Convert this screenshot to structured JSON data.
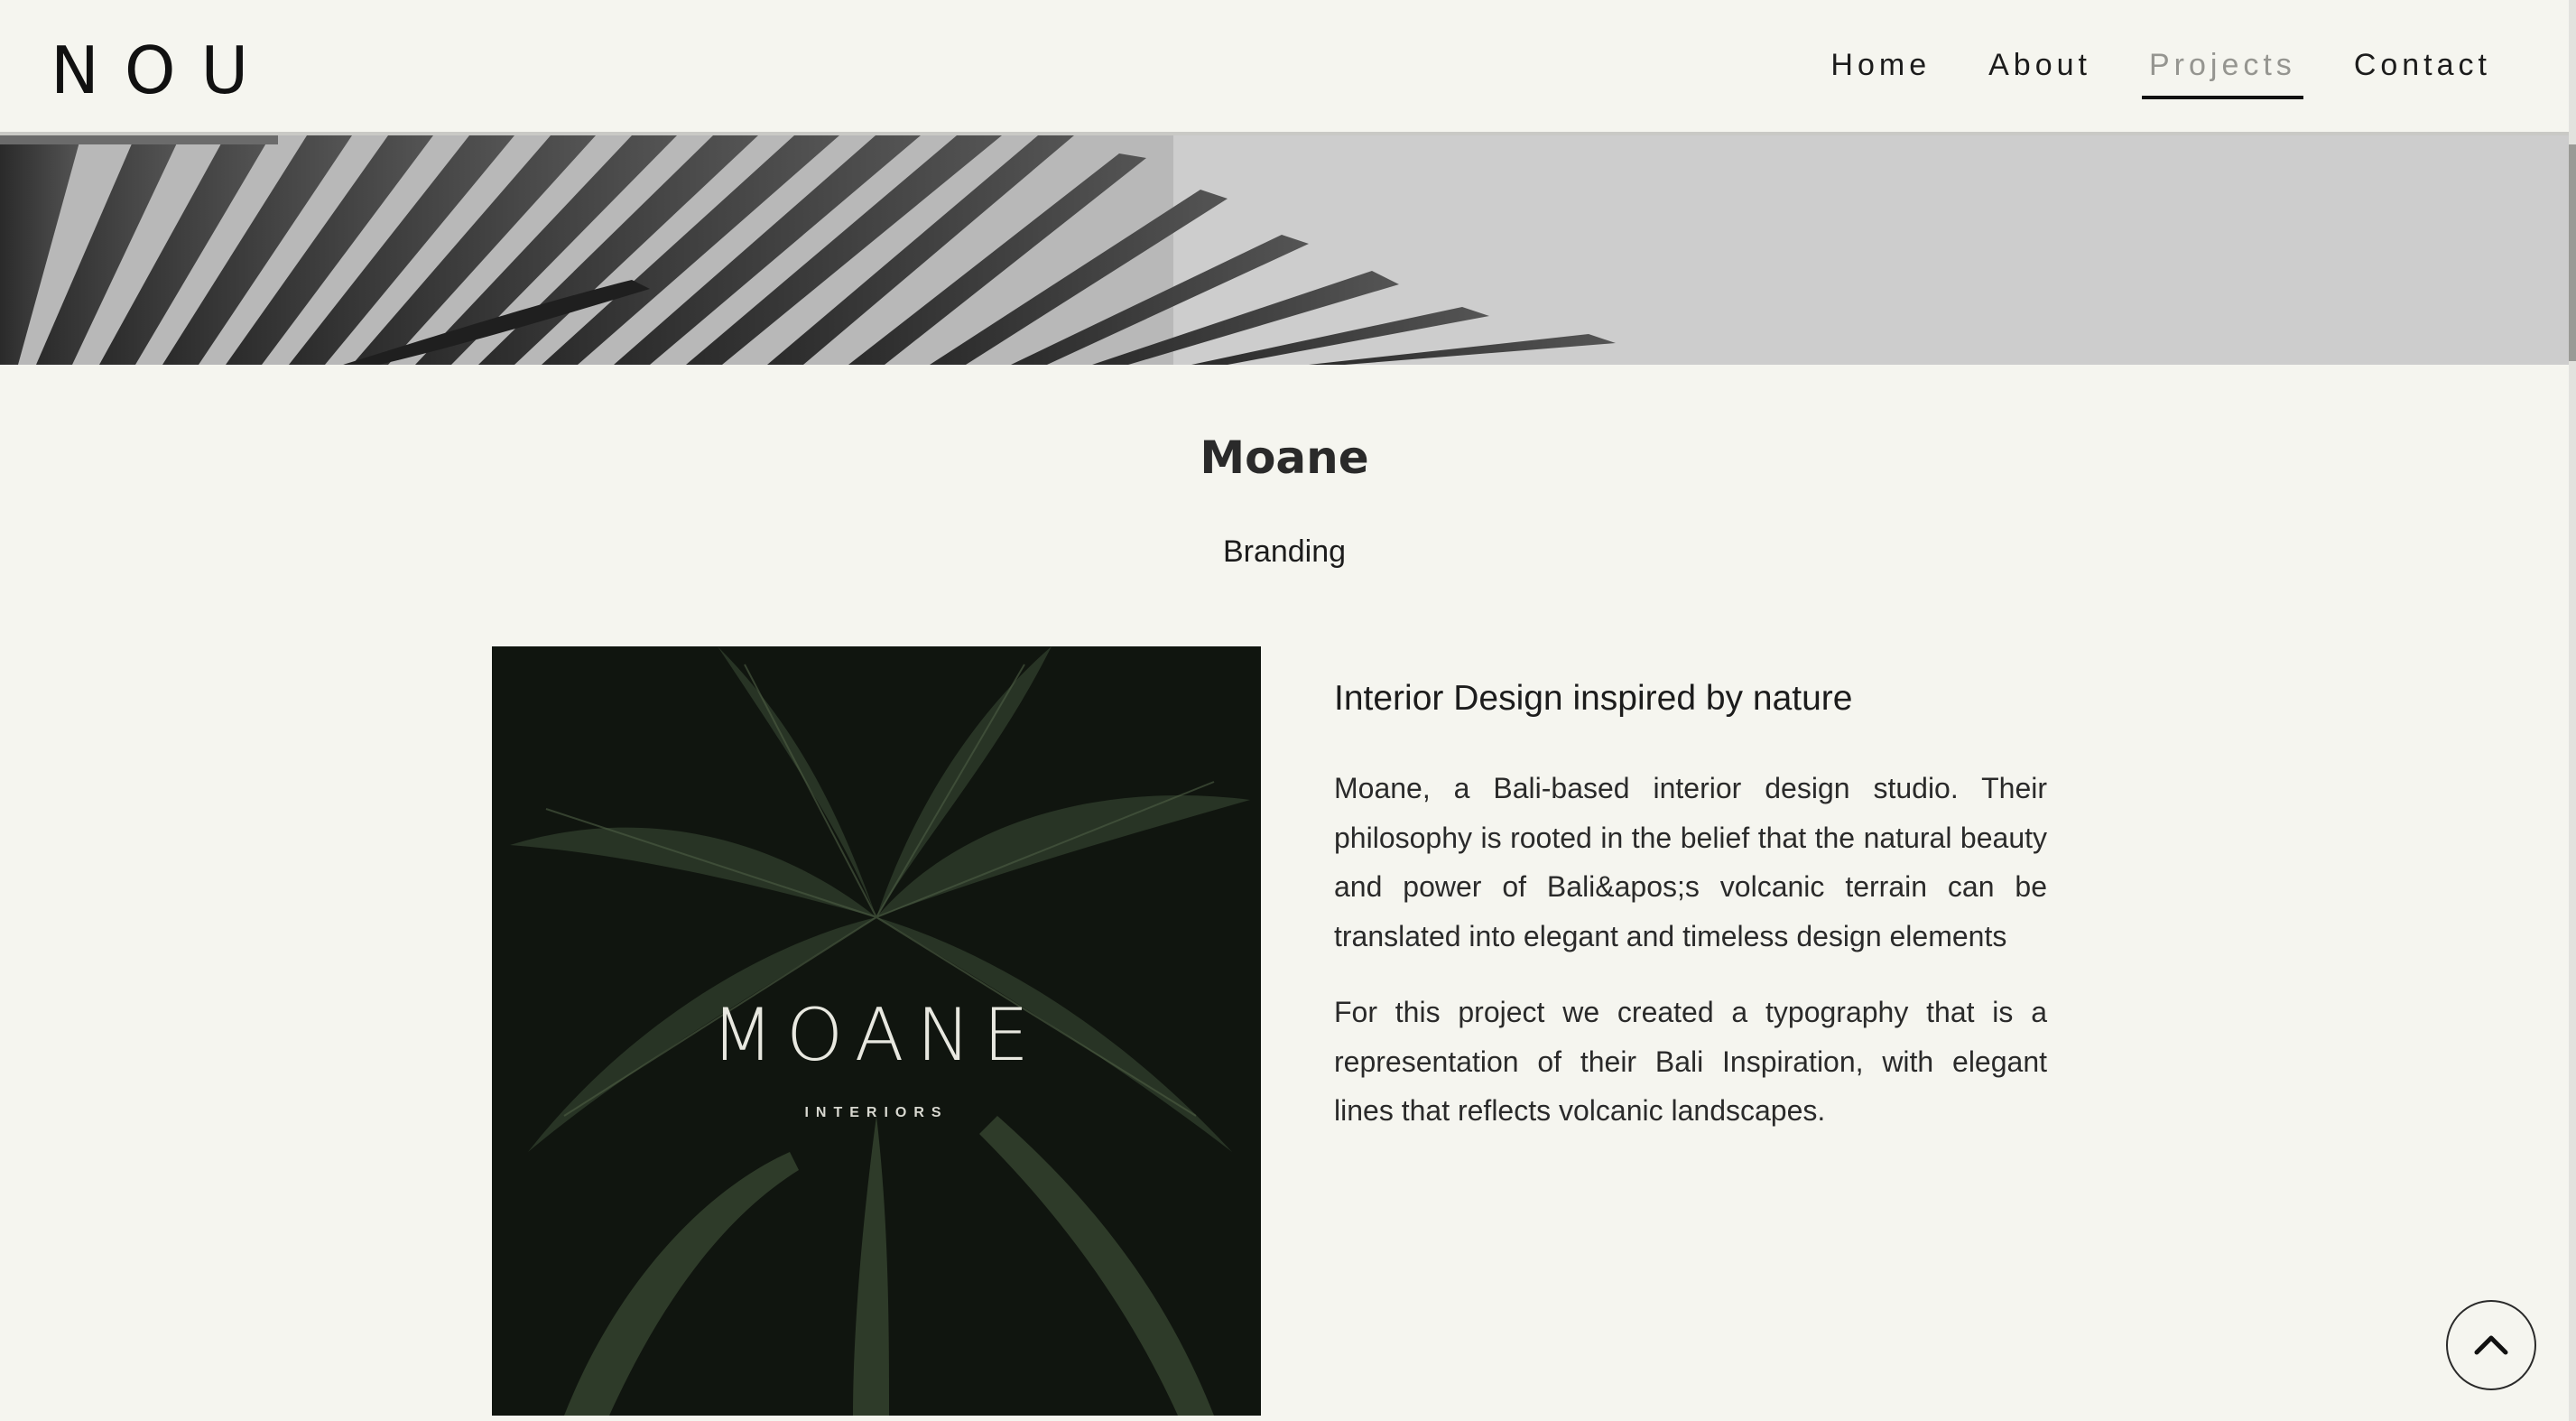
{
  "header": {
    "logo": "NOU",
    "nav": [
      {
        "label": "Home",
        "active": false
      },
      {
        "label": "About",
        "active": false
      },
      {
        "label": "Projects",
        "active": true
      },
      {
        "label": "Contact",
        "active": false
      }
    ]
  },
  "project": {
    "title": "Moane",
    "category": "Branding",
    "image": {
      "brand_text": "MOANE",
      "brand_subtext": "INTERIORS"
    },
    "heading": "Interior Design inspired by nature",
    "paragraphs": [
      "Moane, a Bali-based interior design studio. Their philosophy is rooted in the belief that the natural beauty and power of Bali&apos;s volcanic terrain can be translated into elegant and timeless design elements",
      "For this project we created a typography that is a representation of their Bali Inspiration, with elegant lines that reflects volcanic landscapes."
    ]
  },
  "icons": {
    "back_to_top": "chevron-up-icon"
  },
  "colors": {
    "background": "#f5f5ef",
    "text": "#1c1c1c",
    "nav_active": "#959590"
  }
}
